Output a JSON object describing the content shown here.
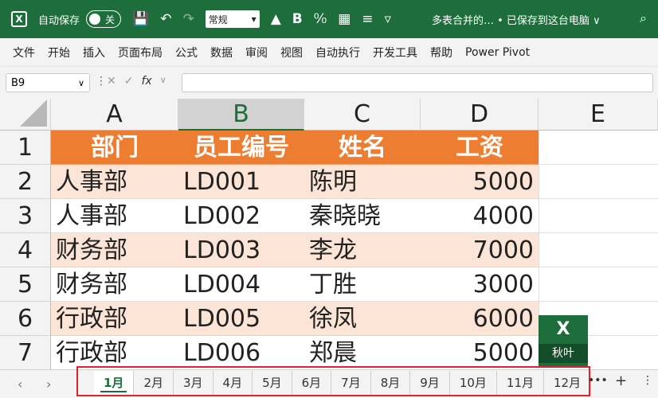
{
  "titlebar": {
    "app_icon": "excel-logo",
    "autosave_label": "自动保存",
    "autosave_state": "关",
    "font_name": "常规",
    "doc_title": "多表合并的… • 已保存到这台电脑 ∨",
    "icons": [
      "save-icon",
      "undo-icon",
      "redo-icon",
      "fill-color-icon",
      "bold-icon",
      "format-icon",
      "number-format-icon",
      "align-icon",
      "more-icon",
      "search-icon"
    ]
  },
  "menu": [
    "文件",
    "开始",
    "插入",
    "页面布局",
    "公式",
    "数据",
    "审阅",
    "视图",
    "自动执行",
    "开发工具",
    "帮助",
    "Power Pivot"
  ],
  "formula_bar": {
    "name_box": "B9",
    "fx_label": "fx",
    "formula": ""
  },
  "grid": {
    "columns": [
      "A",
      "B",
      "C",
      "D",
      "E"
    ],
    "selected_column": "B",
    "rows": [
      "1",
      "2",
      "3",
      "4",
      "5",
      "6",
      "7"
    ],
    "header": [
      "部门",
      "员工编号",
      "姓名",
      "工资"
    ],
    "data": [
      [
        "人事部",
        "LD001",
        "陈明",
        "5000"
      ],
      [
        "人事部",
        "LD002",
        "秦晓晓",
        "4000"
      ],
      [
        "财务部",
        "LD003",
        "李龙",
        "7000"
      ],
      [
        "财务部",
        "LD004",
        "丁胜",
        "3000"
      ],
      [
        "行政部",
        "LD005",
        "徐凤",
        "6000"
      ],
      [
        "行政部",
        "LD006",
        "郑晨",
        "5000"
      ]
    ]
  },
  "watermark": {
    "top": "X",
    "bottom": "秋叶"
  },
  "sheet_tabs": {
    "tabs": [
      "1月",
      "2月",
      "3月",
      "4月",
      "5月",
      "6月",
      "7月",
      "8月",
      "9月",
      "10月",
      "11月",
      "12月"
    ],
    "active": "1月",
    "highlight_color": "#e0232f"
  },
  "colors": {
    "brand": "#1e6e3c",
    "header_fill": "#ed7d31",
    "band_fill": "#fce4d6"
  }
}
